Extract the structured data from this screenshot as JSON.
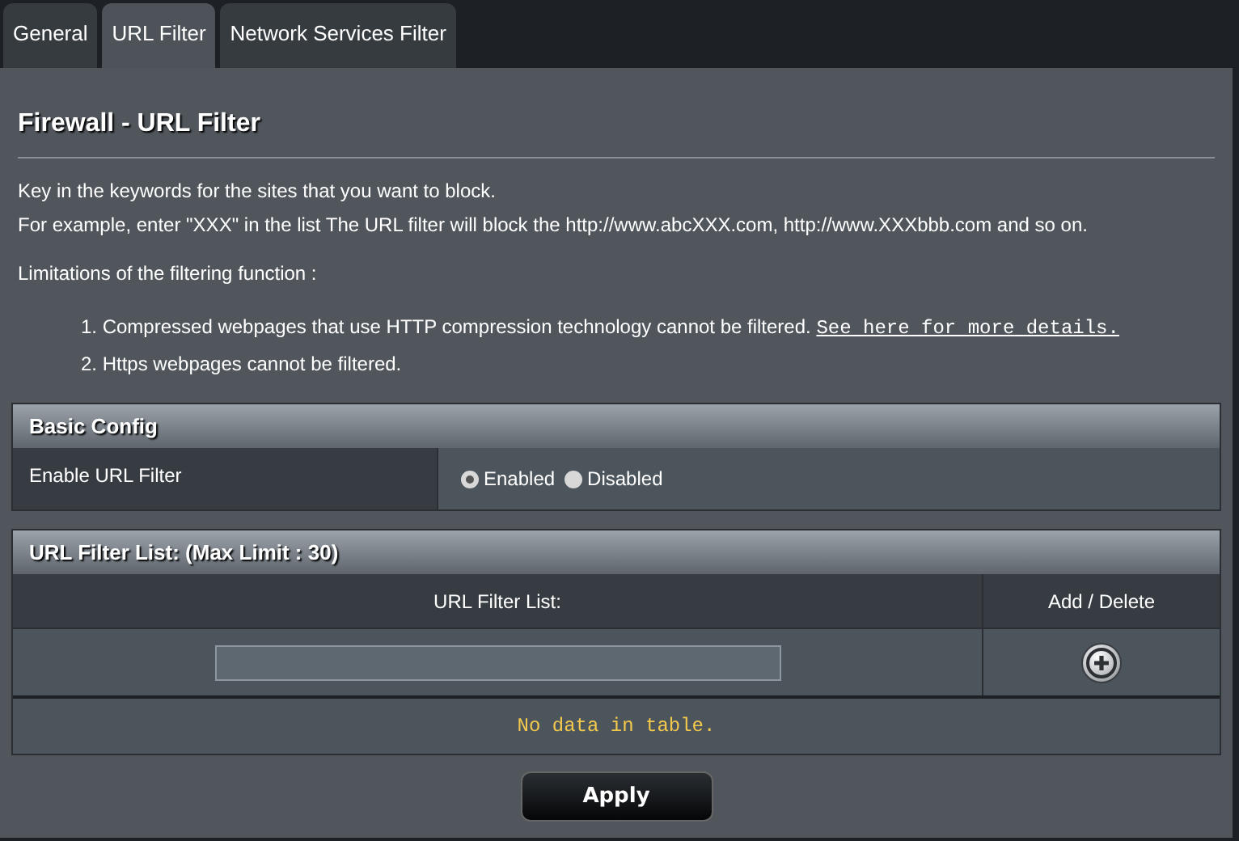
{
  "tabs": [
    {
      "label": "General",
      "selected": false
    },
    {
      "label": "URL Filter",
      "selected": true
    },
    {
      "label": "Network Services Filter",
      "selected": false
    }
  ],
  "title": "Firewall - URL Filter",
  "description": [
    "Key in the keywords for the sites that you want to block.",
    "For example, enter \"XXX\" in the list The URL filter will block the http://www.abcXXX.com, http://www.XXXbbb.com and so on."
  ],
  "limitations_label": "Limitations of the filtering function :",
  "limitations": [
    {
      "number": "1.",
      "text": "Compressed webpages that use HTTP compression technology cannot be filtered.",
      "link": "See here for more details."
    },
    {
      "number": "2.",
      "text": "Https webpages cannot be filtered."
    }
  ],
  "basic_config": {
    "header": "Basic Config",
    "label": "Enable URL Filter",
    "options": [
      {
        "label": "Enabled",
        "selected": true
      },
      {
        "label": "Disabled",
        "selected": false
      }
    ]
  },
  "url_list": {
    "header": "URL Filter List: (Max Limit : 30)",
    "columns": [
      "URL Filter List:",
      "Add / Delete"
    ],
    "empty_message": "No data in table."
  },
  "apply_button": "Apply"
}
